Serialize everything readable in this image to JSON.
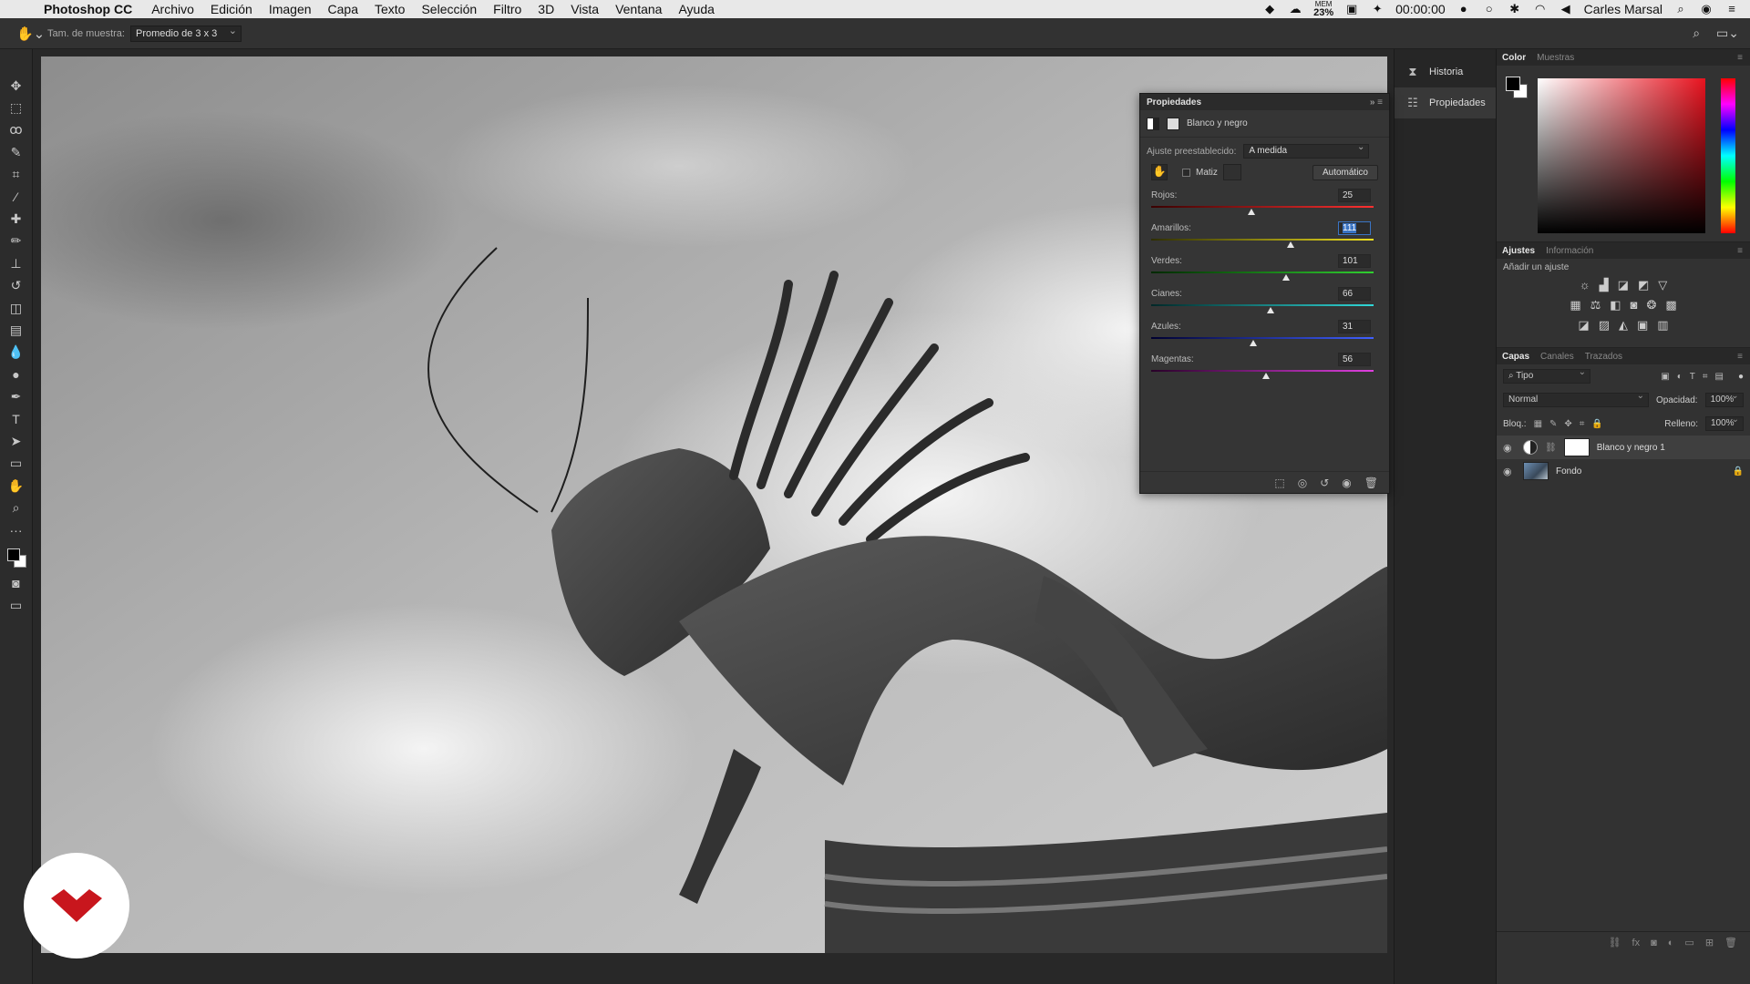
{
  "menubar": {
    "app_name": "Photoshop CC",
    "menus": [
      "Archivo",
      "Edición",
      "Imagen",
      "Capa",
      "Texto",
      "Selección",
      "Filtro",
      "3D",
      "Vista",
      "Ventana",
      "Ayuda"
    ],
    "mem_label": "MEM",
    "mem_value": "23%",
    "timer": "00:00:00",
    "user": "Carles Marsal"
  },
  "options": {
    "sample_label": "Tam. de muestra:",
    "sample_value": "Promedio de 3 x 3"
  },
  "toolbar": {
    "tools": [
      "move-tool-icon",
      "marquee-tool-icon",
      "lasso-tool-icon",
      "quick-select-icon",
      "crop-tool-icon",
      "eyedropper-icon",
      "healing-brush-icon",
      "brush-tool-icon",
      "clone-stamp-icon",
      "history-brush-icon",
      "eraser-icon",
      "gradient-tool-icon",
      "blur-tool-icon",
      "dodge-tool-icon",
      "pen-tool-icon",
      "type-tool-icon",
      "path-select-icon",
      "rectangle-tool-icon",
      "hand-tool-icon",
      "zoom-tool-icon",
      "more-tools-icon"
    ]
  },
  "dock": {
    "historia": "Historia",
    "propiedades": "Propiedades"
  },
  "properties": {
    "title": "Propiedades",
    "adjustment_name": "Blanco y negro",
    "preset_label": "Ajuste preestablecido:",
    "preset_value": "A medida",
    "tint_label": "Matiz",
    "auto_button": "Automático",
    "sliders": [
      {
        "label": "Rojos:",
        "value": "25",
        "pos": 0.45,
        "from": "#3a0000",
        "to": "#ff3030"
      },
      {
        "label": "Amarillos:",
        "value": "111",
        "pos": 0.625,
        "from": "#2e2e00",
        "to": "#f0e020"
      },
      {
        "label": "Verdes:",
        "value": "101",
        "pos": 0.605,
        "from": "#002800",
        "to": "#30d030"
      },
      {
        "label": "Cianes:",
        "value": "66",
        "pos": 0.535,
        "from": "#002828",
        "to": "#30d8d8"
      },
      {
        "label": "Azules:",
        "value": "31",
        "pos": 0.46,
        "from": "#000030",
        "to": "#4060ff"
      },
      {
        "label": "Magentas:",
        "value": "56",
        "pos": 0.515,
        "from": "#280028",
        "to": "#e040e0"
      }
    ]
  },
  "color_panel": {
    "tabs": [
      "Color",
      "Muestras"
    ]
  },
  "adjustments_panel": {
    "tabs": [
      "Ajustes",
      "Información"
    ],
    "subtitle": "Añadir un ajuste"
  },
  "layers_panel": {
    "tabs": [
      "Capas",
      "Canales",
      "Trazados"
    ],
    "filter_value": "Tipo",
    "blend_mode": "Normal",
    "opacity_label": "Opacidad:",
    "opacity_value": "100%",
    "lock_label": "Bloq.:",
    "fill_label": "Relleno:",
    "fill_value": "100%",
    "layers": [
      {
        "name": "Blanco y negro 1"
      },
      {
        "name": "Fondo"
      }
    ]
  }
}
